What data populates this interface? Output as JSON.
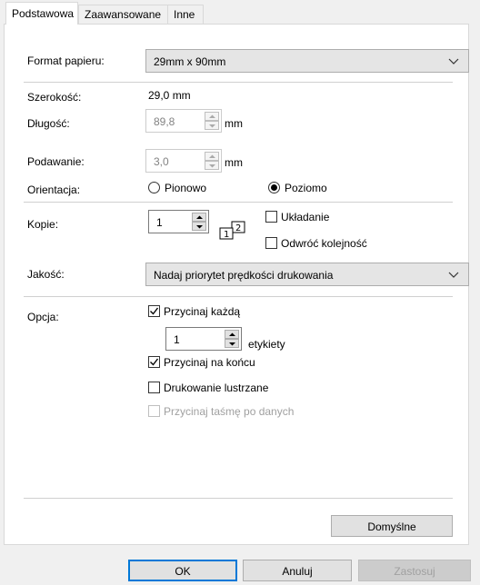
{
  "tabs": [
    {
      "label": "Podstawowa",
      "active": true
    },
    {
      "label": "Zaawansowane",
      "active": false
    },
    {
      "label": "Inne",
      "active": false
    }
  ],
  "paper_format": {
    "label": "Format papieru:",
    "value": "29mm x 90mm"
  },
  "width": {
    "label": "Szerokość:",
    "value": "29,0 mm"
  },
  "length": {
    "label": "Długość:",
    "value": "89,8",
    "unit": "mm"
  },
  "feed": {
    "label": "Podawanie:",
    "value": "3,0",
    "unit": "mm"
  },
  "orientation": {
    "label": "Orientacja:",
    "options": [
      "Pionowo",
      "Poziomo"
    ],
    "selected": "Poziomo"
  },
  "copies": {
    "label": "Kopie:",
    "value": "1",
    "collate_label": "Układanie",
    "reverse_label": "Odwróć kolejność"
  },
  "quality": {
    "label": "Jakość:",
    "value": "Nadaj priorytet prędkości drukowania"
  },
  "option": {
    "label": "Opcja:",
    "cut_each_label": "Przycinaj każdą",
    "cut_each_value": "1",
    "labels_unit": "etykiety",
    "cut_at_end_label": "Przycinaj na końcu",
    "mirror_label": "Drukowanie lustrzane",
    "cut_tape_label": "Przycinaj taśmę po danych"
  },
  "buttons": {
    "defaults": "Domyślne",
    "ok": "OK",
    "cancel": "Anuluj",
    "apply": "Zastosuj"
  }
}
